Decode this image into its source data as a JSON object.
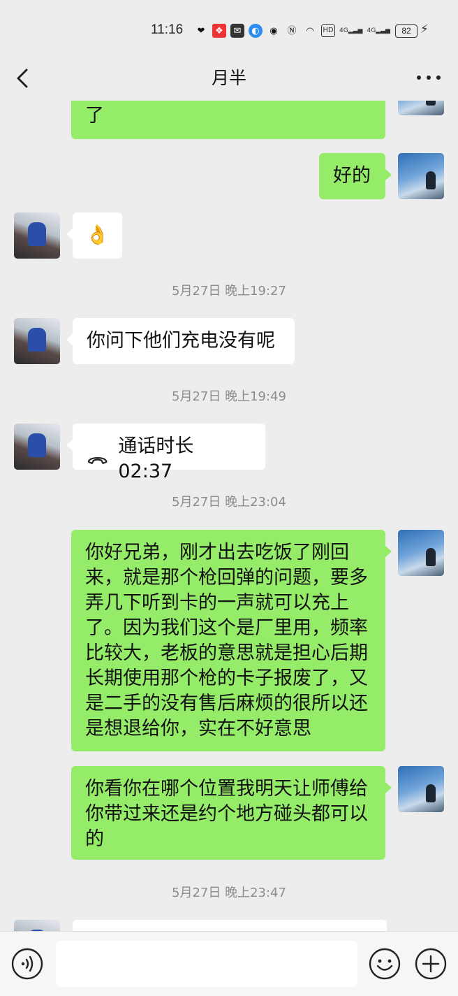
{
  "status_bar": {
    "time": "11:16",
    "battery": "82",
    "network_1": "4G",
    "network_2": "4G",
    "hd_label": "HD"
  },
  "header": {
    "title": "月半"
  },
  "messages": {
    "m0_text": "了",
    "m1_text": "好的",
    "m2_emoji": "👌",
    "ts1": "5月27日 晚上19:27",
    "m3_text": "你问下他们充电没有呢",
    "ts2": "5月27日 晚上19:49",
    "m4_call_text": "通话时长 02:37",
    "ts3": "5月27日 晚上23:04",
    "m5_text": "你好兄弟，刚才出去吃饭了刚回来，就是那个枪回弹的问题，要多弄几下听到卡的一声就可以充上了。因为我们这个是厂里用，频率比较大，老板的意思就是担心后期长期使用那个枪的卡子报废了，又是二手的没有售后麻烦的很所以还是想退给你，实在不好意思",
    "m6_text": "你看你在哪个位置我明天让师傅给你带过来还是约个地方碰头都可以的",
    "ts4": "5月27日 晚上23:47"
  },
  "colors": {
    "my_bubble": "#95ec69",
    "other_bubble": "#ffffff",
    "background": "#ededed"
  },
  "icons": [
    "back-arrow-icon",
    "more-icon",
    "voice-icon",
    "emoji-icon",
    "plus-icon",
    "phone-icon"
  ]
}
